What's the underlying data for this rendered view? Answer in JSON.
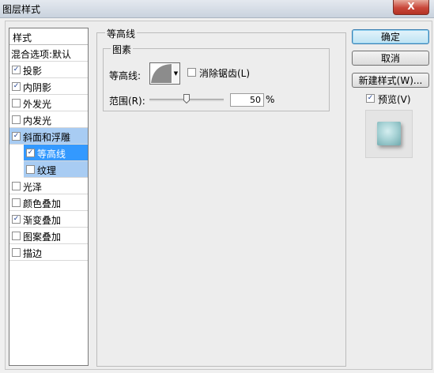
{
  "window": {
    "title": "图层样式",
    "close_label": "X"
  },
  "sidebar": {
    "header": "样式",
    "items": [
      {
        "label": "混合选项:默认",
        "checkbox": false,
        "checked": false,
        "state": "normal"
      },
      {
        "label": "投影",
        "checkbox": true,
        "checked": true,
        "state": "normal"
      },
      {
        "label": "内阴影",
        "checkbox": true,
        "checked": true,
        "state": "normal"
      },
      {
        "label": "外发光",
        "checkbox": true,
        "checked": false,
        "state": "normal"
      },
      {
        "label": "内发光",
        "checkbox": true,
        "checked": false,
        "state": "normal"
      },
      {
        "label": "斜面和浮雕",
        "checkbox": true,
        "checked": true,
        "state": "highlight"
      },
      {
        "label": "等高线",
        "checkbox": true,
        "checked": true,
        "state": "selected"
      },
      {
        "label": "纹理",
        "checkbox": true,
        "checked": false,
        "state": "highlight"
      },
      {
        "label": "光泽",
        "checkbox": true,
        "checked": false,
        "state": "normal"
      },
      {
        "label": "颜色叠加",
        "checkbox": true,
        "checked": false,
        "state": "normal"
      },
      {
        "label": "渐变叠加",
        "checkbox": true,
        "checked": true,
        "state": "normal"
      },
      {
        "label": "图案叠加",
        "checkbox": true,
        "checked": false,
        "state": "normal"
      },
      {
        "label": "描边",
        "checkbox": true,
        "checked": false,
        "state": "normal"
      }
    ]
  },
  "contour_panel": {
    "title": "等高线",
    "elements_group": "图素",
    "contour_label": "等高线:",
    "antialias_label": "消除锯齿(L)",
    "antialias_checked": false,
    "range_label": "范围(R):",
    "range_value": "50",
    "range_unit": "%",
    "range_level": 0.5
  },
  "buttons": {
    "ok": "确定",
    "cancel": "取消",
    "new_style": "新建样式(W)..."
  },
  "preview": {
    "label": "预览(V)",
    "checked": true
  },
  "colors": {
    "selected_bg": "#3399ff",
    "highlight_bg": "#a8ccf3",
    "preview_swatch": "#a8d3d6"
  }
}
